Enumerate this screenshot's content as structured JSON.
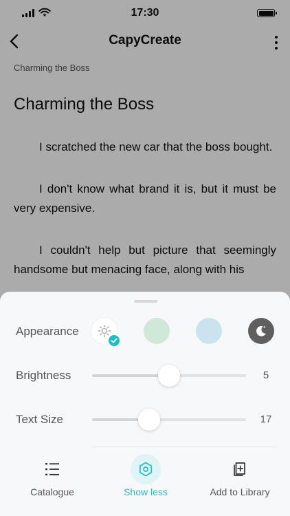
{
  "status_bar": {
    "time": "17:30"
  },
  "nav": {
    "title": "CapyCreate"
  },
  "reader": {
    "breadcrumb": "Charming the Boss",
    "chapter_title": "Charming the Boss",
    "paragraphs": [
      "I scratched the new car that the boss bought.",
      "I don't know what brand it is, but it must be very expensive.",
      "I couldn't help but picture that seemingly handsome but menacing face, along with his"
    ]
  },
  "settings": {
    "appearance_label": "Appearance",
    "appearance_options": [
      "day-theme",
      "green-theme",
      "blue-theme",
      "night-theme"
    ],
    "appearance_selected": "day-theme",
    "brightness_label": "Brightness",
    "brightness_value": "5",
    "brightness_fraction": 0.5,
    "text_size_label": "Text Size",
    "text_size_value": "17",
    "text_size_fraction": 0.37
  },
  "bottom_actions": {
    "catalogue": "Catalogue",
    "show_less": "Show less",
    "add_to_library": "Add to Library"
  },
  "colors": {
    "accent": "#1ebec8",
    "green_theme": "#cfe9d6",
    "blue_theme": "#c9e4ef",
    "night_theme": "#5f5f5f"
  }
}
